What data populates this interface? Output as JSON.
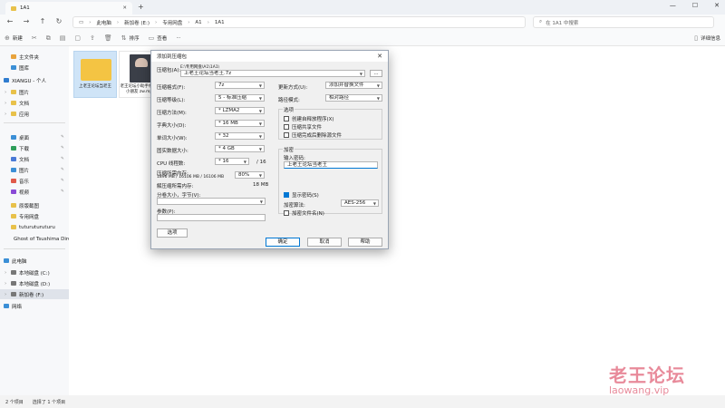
{
  "tab": {
    "title": "1A1"
  },
  "address": {
    "segments": [
      "此电脑",
      "新加卷 (E:)",
      "专用网盘",
      "A1",
      "1A1"
    ],
    "search_placeholder": "在 1A1 中搜索"
  },
  "toolbar": {
    "new": "新建",
    "sort": "排序",
    "view": "查看",
    "more": "···",
    "details": "详细信息"
  },
  "sidebar": {
    "items": [
      {
        "label": "主文件夹",
        "color": "#e8a33c"
      },
      {
        "label": "图库",
        "color": "#3b8fd6"
      },
      {
        "label": "XIANGU - 个人",
        "color": "#2f7ccf"
      },
      {
        "label": "图片",
        "color": "#e8c14a"
      },
      {
        "label": "文档",
        "color": "#e8c14a"
      },
      {
        "label": "应用",
        "color": "#e8c14a"
      },
      {
        "label": "桌面",
        "color": "#3b8fd6"
      },
      {
        "label": "下载",
        "color": "#2f9e5a"
      },
      {
        "label": "文档",
        "color": "#4a7ad6"
      },
      {
        "label": "图片",
        "color": "#3b8fd6"
      },
      {
        "label": "音乐",
        "color": "#e05a4a"
      },
      {
        "label": "视频",
        "color": "#8a4ad6"
      },
      {
        "label": "原版截图",
        "color": "#e8c14a"
      },
      {
        "label": "专用网盘",
        "color": "#e8c14a"
      },
      {
        "label": "tuturuturuturu",
        "color": "#e8c14a"
      },
      {
        "label": "Ghost of Tsushima  Dire",
        "color": "#e8c14a"
      },
      {
        "label": "此电脑",
        "color": "#3b8fd6"
      },
      {
        "label": "本地磁盘 (C:)",
        "color": "#777777"
      },
      {
        "label": "本地磁盘 (D:)",
        "color": "#777777"
      },
      {
        "label": "新加卷 (F:)",
        "color": "#777777"
      },
      {
        "label": "网络",
        "color": "#3b8fd6"
      }
    ]
  },
  "files": [
    {
      "label": "上老王论坛当老王",
      "kind": "folder"
    },
    {
      "label": "老王论坛小助手相继为小朋友 zw.mp4",
      "kind": "video"
    }
  ],
  "status": {
    "count": "2 个项目",
    "selected": "选择了 1 个项目"
  },
  "dialog": {
    "title": "添加到压缩包",
    "archive_label": "压缩包(A):",
    "archive_path": "E:\\专用网盘\\A1\\1A1\\",
    "archive_name": "上老王论坛当老王.7z",
    "browse": "...",
    "format_label": "压缩格式(F):",
    "format_value": "7z",
    "level_label": "压缩等级(L):",
    "level_value": "5 - 标准压缩",
    "method_label": "压缩方法(M):",
    "method_value": "* LZMA2",
    "dict_label": "字典大小(D):",
    "dict_value": "* 16 MB",
    "word_label": "单词大小(W):",
    "word_value": "* 32",
    "solid_label": "固实数据大小:",
    "solid_value": "* 4 GB",
    "cpu_label": "CPU 线程数:",
    "cpu_value": "* 16",
    "cpu_total": "/ 16",
    "mem_label": "压缩所需内存:",
    "mem_detail": "1896 MB / 16106 MB / 16106 MB",
    "mem_percent": "80%",
    "decomp_label": "解压缩所需内存:",
    "decomp_value": "18 MB",
    "split_label": "分卷大小，字节(V):",
    "params_label": "参数(P):",
    "options_btn": "选项",
    "update_label": "更新方式(U):",
    "update_value": "添加并替换文件",
    "path_label": "路径模式:",
    "path_value": "相对路径",
    "options_group": "选项",
    "opt1": "创建自释放程序(X)",
    "opt2": "压缩共享文件",
    "opt3": "压缩完成后删除源文件",
    "encrypt_group": "加密",
    "pwd_label": "输入密码:",
    "pwd_value": "上老王论坛当老王",
    "show_pwd": "显示密码(S)",
    "enc_method_label": "加密算法:",
    "enc_method_value": "AES-256",
    "enc_names": "加密文件名(N)",
    "ok": "确定",
    "cancel": "取消",
    "help": "帮助"
  },
  "watermark": {
    "cn": "老王论坛",
    "en": "laowang.vip"
  }
}
